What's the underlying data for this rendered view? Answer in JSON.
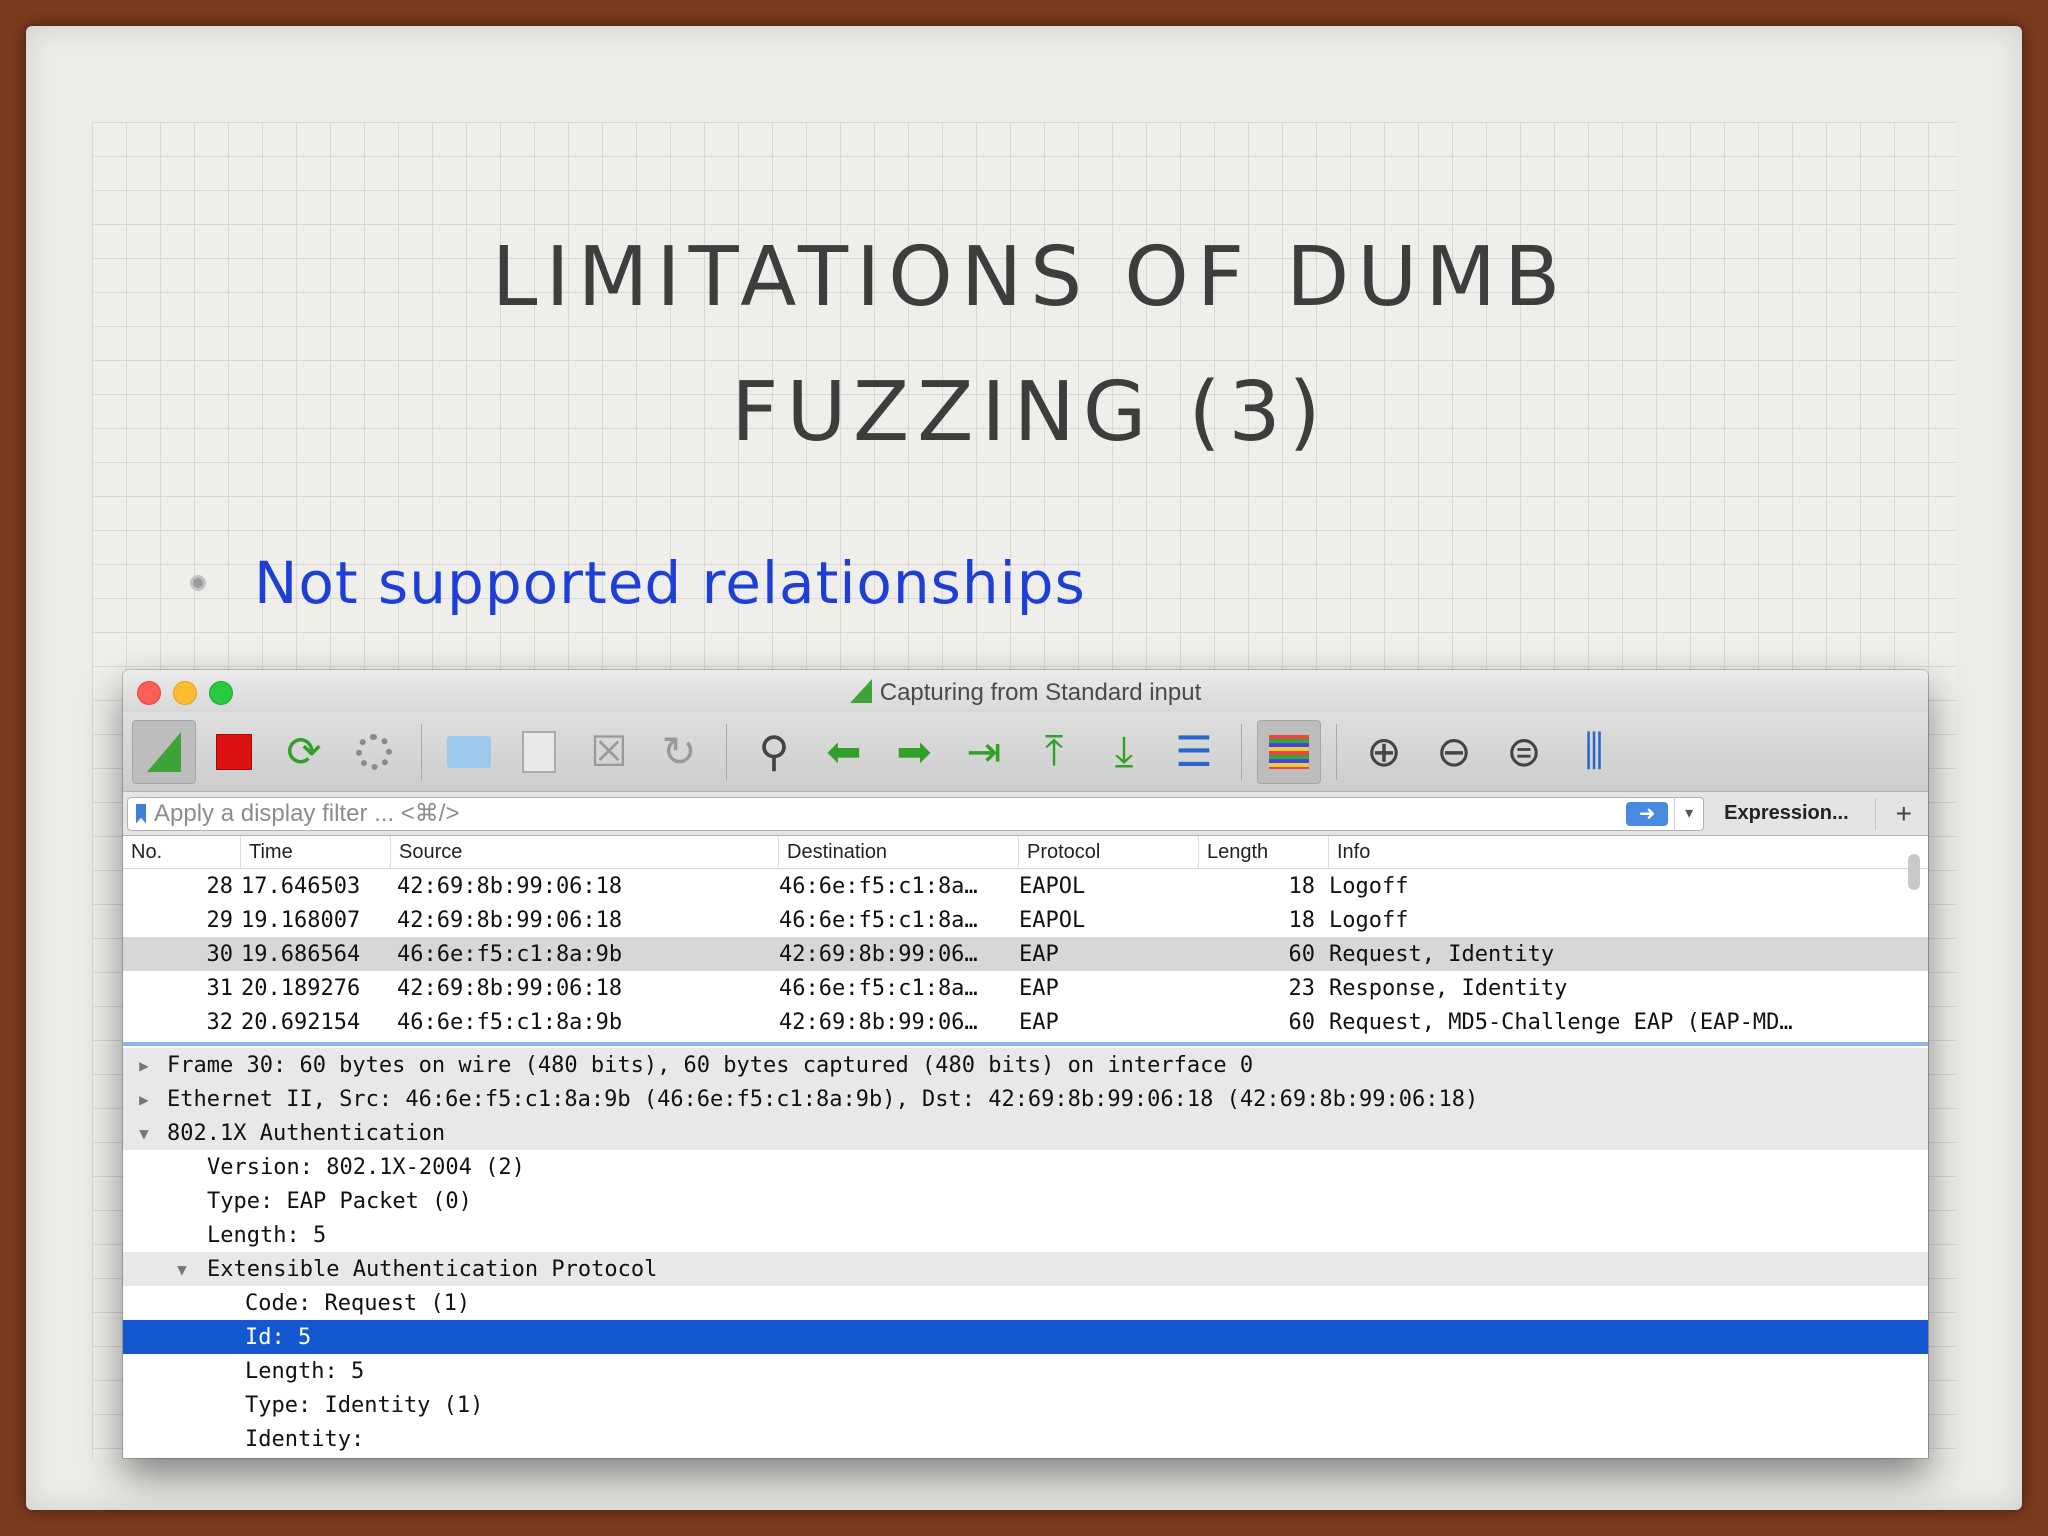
{
  "slide": {
    "title_line1": "LIMITATIONS OF DUMB",
    "title_line2": "FUZZING (3)",
    "bullet": "Not supported relationships"
  },
  "window": {
    "title": "Capturing from Standard input"
  },
  "filter": {
    "placeholder": "Apply a display filter ... <⌘/>",
    "expression_label": "Expression...",
    "add_label": "+"
  },
  "packet_list": {
    "columns": [
      "No.",
      "Time",
      "Source",
      "Destination",
      "Protocol",
      "Length",
      "Info"
    ],
    "rows": [
      {
        "no": "28",
        "time": "17.646503",
        "source": "42:69:8b:99:06:18",
        "destination": "46:6e:f5:c1:8a…",
        "protocol": "EAPOL",
        "length": "18",
        "info": "Logoff"
      },
      {
        "no": "29",
        "time": "19.168007",
        "source": "42:69:8b:99:06:18",
        "destination": "46:6e:f5:c1:8a…",
        "protocol": "EAPOL",
        "length": "18",
        "info": "Logoff"
      },
      {
        "no": "30",
        "time": "19.686564",
        "source": "46:6e:f5:c1:8a:9b",
        "destination": "42:69:8b:99:06…",
        "protocol": "EAP",
        "length": "60",
        "info": "Request, Identity"
      },
      {
        "no": "31",
        "time": "20.189276",
        "source": "42:69:8b:99:06:18",
        "destination": "46:6e:f5:c1:8a…",
        "protocol": "EAP",
        "length": "23",
        "info": "Response, Identity"
      },
      {
        "no": "32",
        "time": "20.692154",
        "source": "46:6e:f5:c1:8a:9b",
        "destination": "42:69:8b:99:06…",
        "protocol": "EAP",
        "length": "60",
        "info": "Request, MD5-Challenge EAP (EAP-MD…"
      }
    ],
    "selected_row": "30"
  },
  "details": {
    "frame": "Frame 30: 60 bytes on wire (480 bits), 60 bytes captured (480 bits) on interface 0",
    "ethernet": "Ethernet II, Src: 46:6e:f5:c1:8a:9b (46:6e:f5:c1:8a:9b), Dst: 42:69:8b:99:06:18 (42:69:8b:99:06:18)",
    "dot1x": "802.1X Authentication",
    "version": "Version: 802.1X-2004 (2)",
    "type": "Type: EAP Packet (0)",
    "length": "Length: 5",
    "eap": "Extensible Authentication Protocol",
    "code": "Code: Request (1)",
    "id": "Id: 5",
    "eap_length": "Length: 5",
    "eap_type": "Type: Identity (1)",
    "identity": "Identity:"
  },
  "icons": {
    "collapsed": "▶",
    "expanded": "▼"
  }
}
